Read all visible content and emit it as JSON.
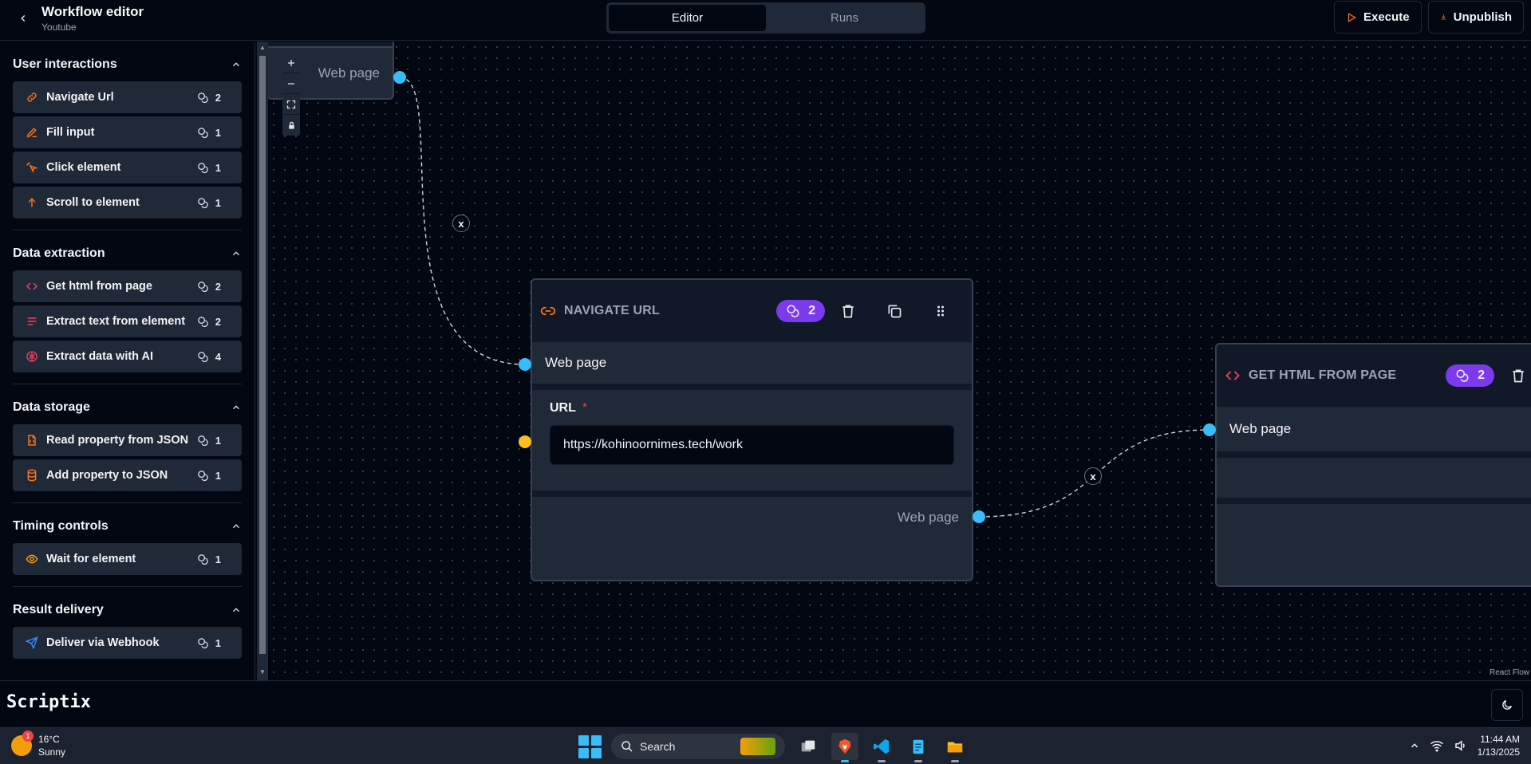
{
  "header": {
    "title": "Workflow editor",
    "subtitle": "Youtube",
    "tabs": [
      {
        "label": "Editor",
        "active": true
      },
      {
        "label": "Runs",
        "active": false
      }
    ],
    "execute_label": "Execute",
    "unpublish_label": "Unpublish",
    "accent_color": "#f97316"
  },
  "sidebar": {
    "sections": [
      {
        "title": "User interactions",
        "items": [
          {
            "label": "Navigate Url",
            "icon": "link-icon",
            "credits": "2"
          },
          {
            "label": "Fill input",
            "icon": "pencil-icon",
            "credits": "1"
          },
          {
            "label": "Click element",
            "icon": "pointer-click-icon",
            "credits": "1"
          },
          {
            "label": "Scroll to element",
            "icon": "arrow-up-icon",
            "credits": "1"
          }
        ]
      },
      {
        "title": "Data extraction",
        "items": [
          {
            "label": "Get html from page",
            "icon": "code-icon",
            "credits": "2"
          },
          {
            "label": "Extract text from element",
            "icon": "text-lines-icon",
            "credits": "2"
          },
          {
            "label": "Extract data with AI",
            "icon": "brain-icon",
            "credits": "4"
          }
        ]
      },
      {
        "title": "Data storage",
        "items": [
          {
            "label": "Read property from JSON",
            "icon": "file-json-icon",
            "credits": "1"
          },
          {
            "label": "Add property to JSON",
            "icon": "database-icon",
            "credits": "1"
          }
        ]
      },
      {
        "title": "Timing controls",
        "items": [
          {
            "label": "Wait for element",
            "icon": "eye-icon",
            "credits": "1"
          }
        ]
      },
      {
        "title": "Result delivery",
        "items": [
          {
            "label": "Deliver via Webhook",
            "icon": "send-icon",
            "credits": "1"
          }
        ]
      }
    ]
  },
  "canvas": {
    "controls": [
      "+",
      "—",
      "fit-view-icon",
      "lock-icon"
    ],
    "attribution": "React Flow",
    "partial_node": {
      "output_label": "Web page"
    },
    "navigate_node": {
      "title": "NAVIGATE URL",
      "credits": "2",
      "input_label": "Web page",
      "url_label": "URL",
      "required_mark": "*",
      "url_value": "https://kohinoornimes.tech/work",
      "output_label": "Web page"
    },
    "gethtml_node": {
      "title": "GET HTML FROM PAGE",
      "credits": "2",
      "input_label": "Web page"
    },
    "edge_button_label": "x"
  },
  "footer": {
    "brand": "Scriptix"
  },
  "taskbar": {
    "weather_temp": "16°C",
    "weather_desc": "Sunny",
    "weather_badge": "1",
    "search_placeholder": "Search",
    "time": "11:44 AM",
    "date": "1/13/2025"
  }
}
